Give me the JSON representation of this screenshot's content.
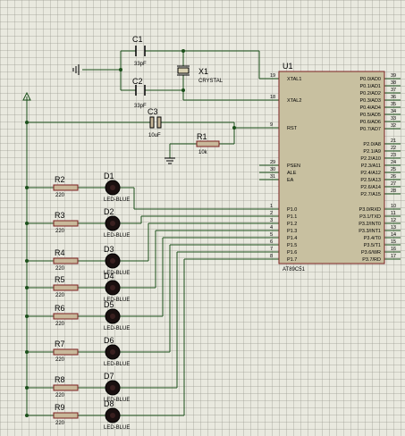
{
  "components": {
    "c1": {
      "ref": "C1",
      "value": "33pF"
    },
    "c2": {
      "ref": "C2",
      "value": "33pF"
    },
    "c3": {
      "ref": "C3",
      "value": "10uF"
    },
    "x1": {
      "ref": "X1",
      "value": "CRYSTAL"
    },
    "r1": {
      "ref": "R1",
      "value": "10k"
    },
    "u1": {
      "ref": "U1",
      "part": "AT89C51"
    }
  },
  "resistors": [
    {
      "ref": "R2",
      "value": "220"
    },
    {
      "ref": "R3",
      "value": "220"
    },
    {
      "ref": "R4",
      "value": "220"
    },
    {
      "ref": "R5",
      "value": "220"
    },
    {
      "ref": "R6",
      "value": "220"
    },
    {
      "ref": "R7",
      "value": "220"
    },
    {
      "ref": "R8",
      "value": "220"
    },
    {
      "ref": "R9",
      "value": "220"
    }
  ],
  "leds": [
    {
      "ref": "D1",
      "value": "LED-BLUE"
    },
    {
      "ref": "D2",
      "value": "LED-BLUE"
    },
    {
      "ref": "D3",
      "value": "LED-BLUE"
    },
    {
      "ref": "D4",
      "value": "LED-BLUE"
    },
    {
      "ref": "D5",
      "value": "LED-BLUE"
    },
    {
      "ref": "D6",
      "value": "LED-BLUE"
    },
    {
      "ref": "D7",
      "value": "LED-BLUE"
    },
    {
      "ref": "D8",
      "value": "LED-BLUE"
    }
  ],
  "u1_left_pins": [
    {
      "num": "19",
      "name": "XTAL1"
    },
    {
      "num": "18",
      "name": "XTAL2"
    },
    {
      "num": "9",
      "name": "RST"
    },
    {
      "num": "29",
      "name": "PSEN"
    },
    {
      "num": "30",
      "name": "ALE"
    },
    {
      "num": "31",
      "name": "EA"
    },
    {
      "num": "1",
      "name": "P1.0"
    },
    {
      "num": "2",
      "name": "P1.1"
    },
    {
      "num": "3",
      "name": "P1.2"
    },
    {
      "num": "4",
      "name": "P1.3"
    },
    {
      "num": "5",
      "name": "P1.4"
    },
    {
      "num": "6",
      "name": "P1.5"
    },
    {
      "num": "7",
      "name": "P1.6"
    },
    {
      "num": "8",
      "name": "P1.7"
    }
  ],
  "u1_right_pins": [
    {
      "num": "39",
      "name": "P0.0/AD0"
    },
    {
      "num": "38",
      "name": "P0.1/AD1"
    },
    {
      "num": "37",
      "name": "P0.2/AD2"
    },
    {
      "num": "36",
      "name": "P0.3/AD3"
    },
    {
      "num": "35",
      "name": "P0.4/AD4"
    },
    {
      "num": "34",
      "name": "P0.5/AD5"
    },
    {
      "num": "33",
      "name": "P0.6/AD6"
    },
    {
      "num": "32",
      "name": "P0.7/AD7"
    },
    {
      "num": "21",
      "name": "P2.0/A8"
    },
    {
      "num": "22",
      "name": "P2.1/A9"
    },
    {
      "num": "23",
      "name": "P2.2/A10"
    },
    {
      "num": "24",
      "name": "P2.3/A11"
    },
    {
      "num": "25",
      "name": "P2.4/A12"
    },
    {
      "num": "26",
      "name": "P2.5/A13"
    },
    {
      "num": "27",
      "name": "P2.6/A14"
    },
    {
      "num": "28",
      "name": "P2.7/A15"
    },
    {
      "num": "10",
      "name": "P3.0/RXD"
    },
    {
      "num": "11",
      "name": "P3.1/TXD"
    },
    {
      "num": "12",
      "name": "P3.2/INT0"
    },
    {
      "num": "13",
      "name": "P3.3/INT1"
    },
    {
      "num": "14",
      "name": "P3.4/T0"
    },
    {
      "num": "15",
      "name": "P3.5/T1"
    },
    {
      "num": "16",
      "name": "P3.6/WR"
    },
    {
      "num": "17",
      "name": "P3.7/RD"
    }
  ],
  "colors": {
    "wire": "#1a4f1a",
    "chip_fill": "#c8c0a0",
    "chip_border": "#7a2020",
    "led": "#1a1010",
    "resistor_fill": "#c8b89a"
  }
}
